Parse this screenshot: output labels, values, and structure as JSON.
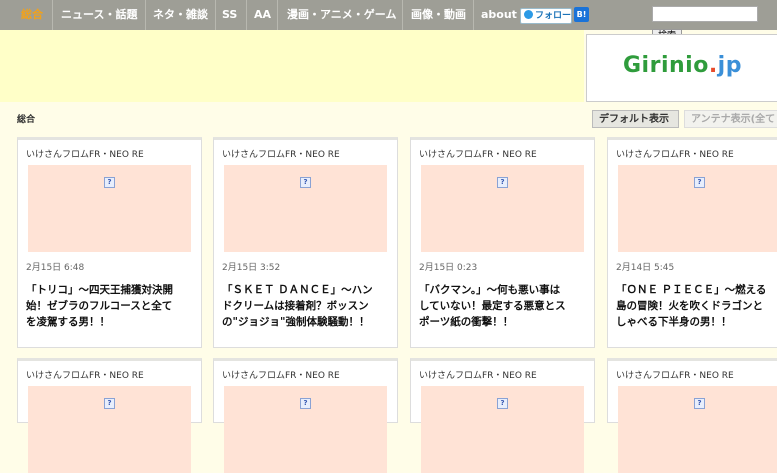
{
  "nav": {
    "items": [
      {
        "label": "総合",
        "active": true
      },
      {
        "label": "ニュース・話題",
        "active": false
      },
      {
        "label": "ネタ・雑談",
        "active": false
      },
      {
        "label": "SS",
        "active": false
      },
      {
        "label": "AA",
        "active": false
      },
      {
        "label": "漫画・アニメ・ゲーム",
        "active": false
      },
      {
        "label": "画像・動画",
        "active": false
      },
      {
        "label": "about",
        "active": false
      }
    ],
    "twitter_label": "フォロー",
    "hatena_label": "B!"
  },
  "search": {
    "value": "",
    "button_label": "検索"
  },
  "logo": {
    "text_main": "Girinio",
    "text_dot": ".",
    "text_tld": "jp"
  },
  "section": {
    "label": "総合"
  },
  "view_tabs": {
    "default_label": "デフォルト表示",
    "antenna_label": "アンテナ表示(全て"
  },
  "cards": [
    {
      "source": "いけさんフロムFR・NEO RE",
      "date": "2月15日 6:48",
      "title": "「トリコ」～四天王捕獲対決開\n始！ゼブラのフルコースと全て\nを凌駕する男！！"
    },
    {
      "source": "いけさんフロムFR・NEO RE",
      "date": "2月15日 3:52",
      "title": "「ＳＫＥＴ ＤＡＮＣＥ」～ハン\nドクリームは接着剤？ボッスン\nの\"ジョジョ\"強制体験騒動！！"
    },
    {
      "source": "いけさんフロムFR・NEO RE",
      "date": "2月15日 0:23",
      "title": "「バクマン。」～何も悪い事は\nしていない！最定する悪意とス\nポーツ紙の衝撃！！"
    },
    {
      "source": "いけさんフロムFR・NEO RE",
      "date": "2月14日 5:45",
      "title": "「ＯＮＥ ＰＩＥＣＥ」～燃える\n島の冒険！火を吹くドラゴンと\nしゃべる下半身の男！！"
    },
    {
      "source": "いけさんフロムFR・NEO RE",
      "date": "",
      "title": ""
    },
    {
      "source": "いけさんフロムFR・NEO RE",
      "date": "",
      "title": ""
    },
    {
      "source": "いけさんフロムFR・NEO RE",
      "date": "",
      "title": ""
    },
    {
      "source": "いけさんフロムFR・NEO RE",
      "date": "",
      "title": ""
    }
  ],
  "icons": {
    "broken_image": "?"
  }
}
